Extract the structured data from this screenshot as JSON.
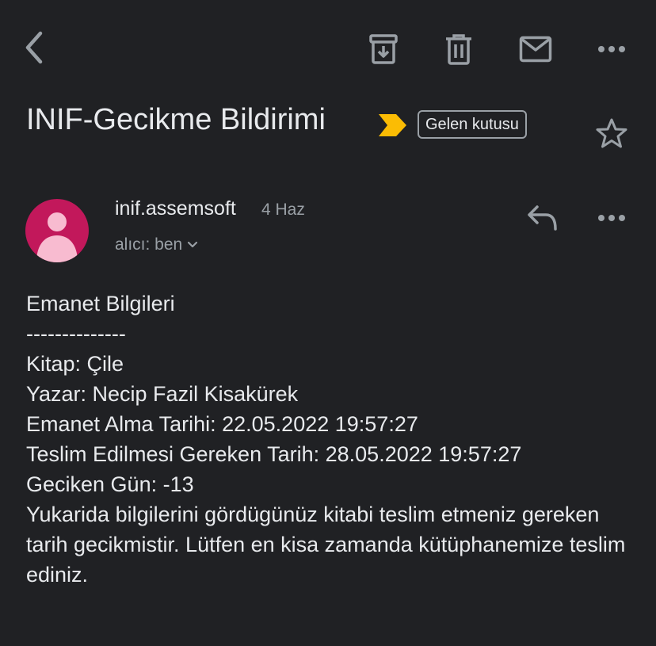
{
  "toolbar": {
    "back_icon": "chevron-left-icon",
    "archive_icon": "archive-icon",
    "delete_icon": "trash-icon",
    "mark_unread_icon": "mail-icon",
    "more_icon": "more-horizontal-icon"
  },
  "message": {
    "subject": "INIF-Gecikme Bildirimi",
    "importance_color": "#fbbc04",
    "label": "Gelen kutusu",
    "sender": {
      "name": "inif.assemsoft",
      "date": "4 Haz",
      "recipient": "alıcı: ben",
      "avatar_color": "#c2185b"
    },
    "body": {
      "heading": "Emanet Bilgileri",
      "separator": "--------------",
      "book": "Kitap: Çile",
      "author": "Yazar: Necip Fazil Kisakürek",
      "loan_date": "Emanet Alma Tarihi: 22.05.2022 19:57:27",
      "due_date": "Teslim Edilmesi Gereken Tarih: 28.05.2022 19:57:27",
      "late_days": "Geciken Gün: -13",
      "notice": "Yukarida bilgilerini gördügünüz kitabi teslim etmeniz gereken tarih gecikmistir. Lütfen en kisa zamanda kütüphanemize teslim ediniz."
    }
  }
}
